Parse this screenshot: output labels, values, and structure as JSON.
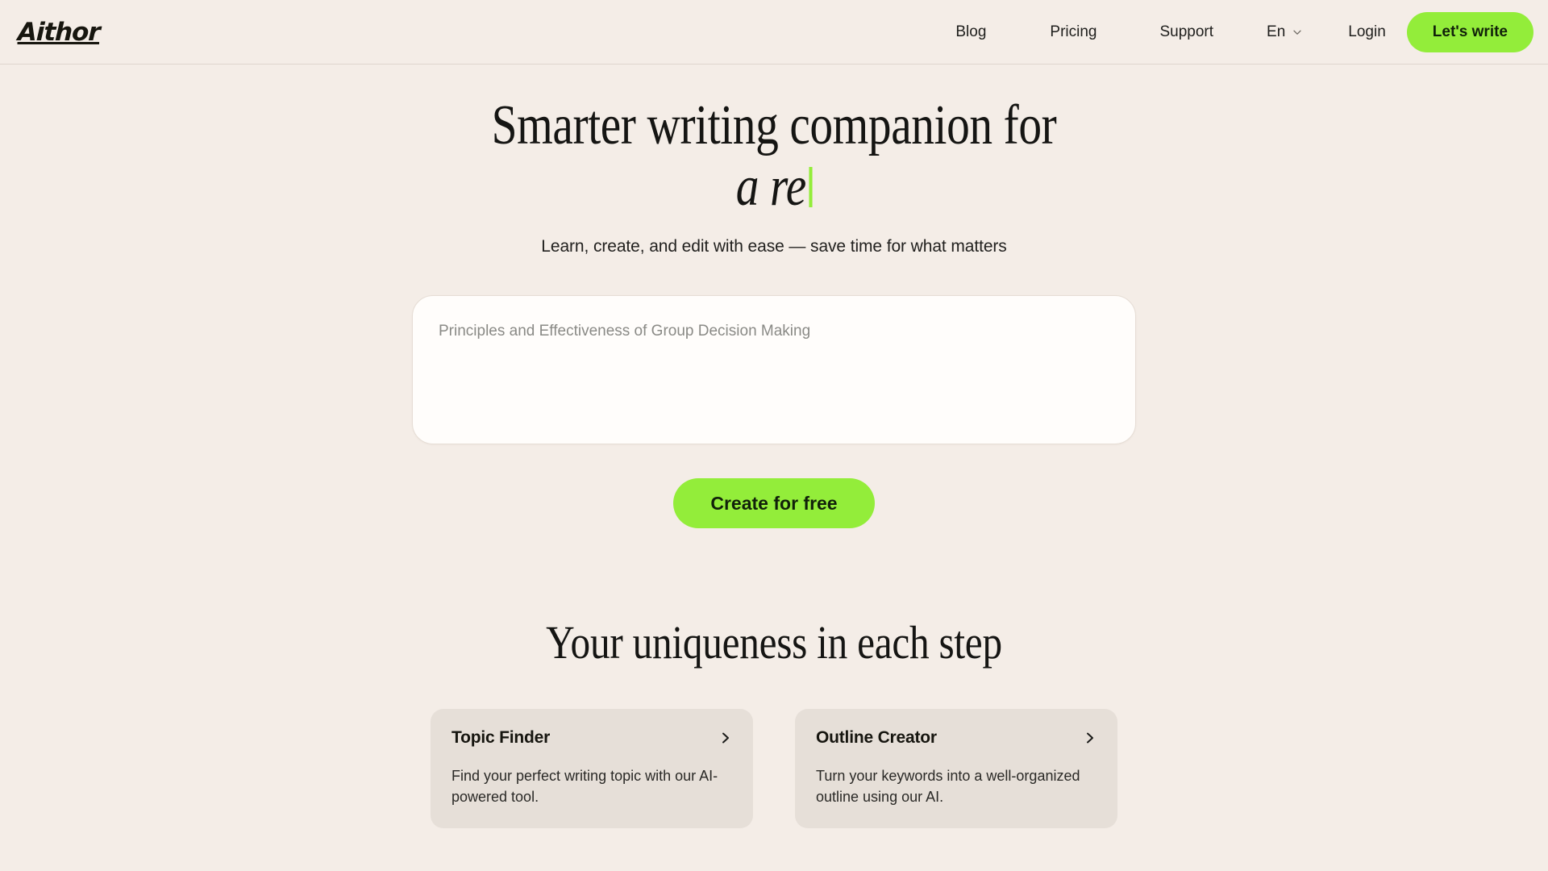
{
  "brand": {
    "name": "Aithor"
  },
  "header": {
    "nav": [
      {
        "label": "Blog"
      },
      {
        "label": "Pricing"
      },
      {
        "label": "Support"
      }
    ],
    "language": {
      "label": "En",
      "icon": "chevron-down-icon"
    },
    "login_label": "Login",
    "cta_label": "Let's write",
    "accent_color": "#93ED3A"
  },
  "hero": {
    "title_line1": "Smarter writing companion for",
    "title_line2": "a re",
    "subtitle": "Learn, create, and edit with ease — save time for what matters",
    "caret_color": "#93ED3A"
  },
  "composer": {
    "placeholder": "Principles and Effectiveness of Group Decision Making",
    "value": "",
    "submit_label": "Create for free"
  },
  "features": {
    "title": "Your uniqueness in each step",
    "cards": [
      {
        "title": "Topic Finder",
        "description": "Find your perfect writing topic with our AI-powered tool.",
        "icon": "chevron-right-icon"
      },
      {
        "title": "Outline Creator",
        "description": "Turn your keywords into a well-organized outline using our AI.",
        "icon": "chevron-right-icon"
      }
    ]
  },
  "colors": {
    "page_background": "#F4EDE7",
    "card_background": "#E6DFD8",
    "accent_green": "#93ED3A",
    "text_primary": "#1A1A18"
  }
}
